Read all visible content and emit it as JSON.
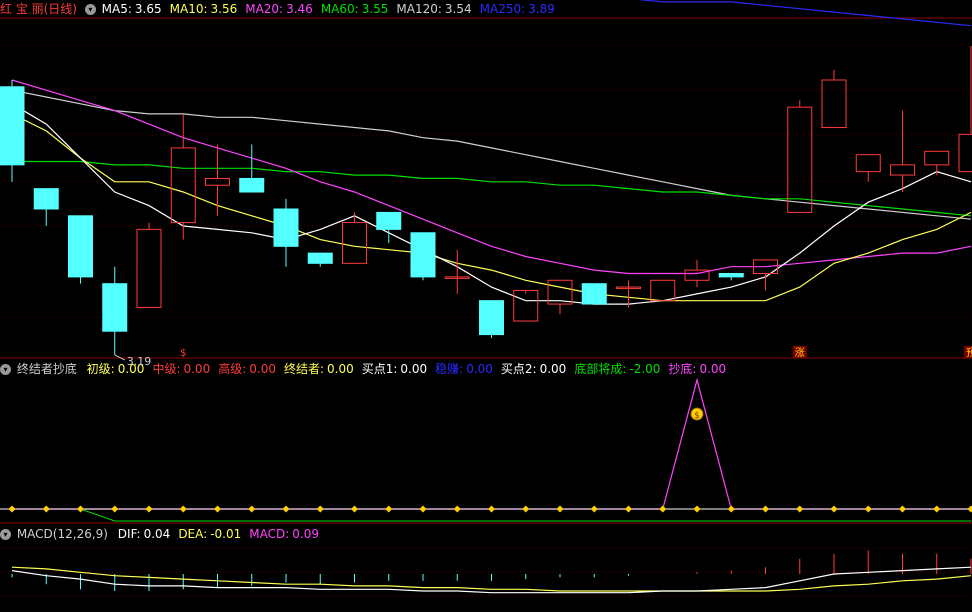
{
  "colors": {
    "up": "#ff3b3b",
    "down": "#54ffff",
    "ma5": "#ffffff",
    "ma10": "#ffff54",
    "ma20": "#ff44ff",
    "ma60": "#00e000",
    "ma120": "#cfcfcf",
    "ma250": "#2a2aff"
  },
  "panel1": {
    "title": "红 宝 丽(日线)",
    "indicators": [
      {
        "label": "MA5:",
        "value": "3.65",
        "color": "#ffffff"
      },
      {
        "label": "MA10:",
        "value": "3.56",
        "color": "#ffff54"
      },
      {
        "label": "MA20:",
        "value": "3.46",
        "color": "#ff44ff"
      },
      {
        "label": "MA60:",
        "value": "3.55",
        "color": "#00e000"
      },
      {
        "label": "MA120:",
        "value": "3.54",
        "color": "#cfcfcf"
      },
      {
        "label": "MA250:",
        "value": "3.89",
        "color": "#2a2aff"
      }
    ],
    "low_label": "3.19",
    "markers": [
      "$",
      "涨",
      "预"
    ]
  },
  "panel2": {
    "title": "终结者抄底",
    "indicators": [
      {
        "label": "初级:",
        "value": "0.00",
        "color": "#ffff54"
      },
      {
        "label": "中级:",
        "value": "0.00",
        "color": "#ff3b3b"
      },
      {
        "label": "高级:",
        "value": "0.00",
        "color": "#ff3b3b"
      },
      {
        "label": "终结者:",
        "value": "0.00",
        "color": "#ffff54"
      },
      {
        "label": "买点1:",
        "value": "0.00",
        "color": "#ffffff"
      },
      {
        "label": "稳赚:",
        "value": "0.00",
        "color": "#2a2aff"
      },
      {
        "label": "买点2:",
        "value": "0.00",
        "color": "#ffffff"
      },
      {
        "label": "底部将成:",
        "value": "-2.00",
        "color": "#00e000"
      },
      {
        "label": "抄底:",
        "value": "0.00",
        "color": "#ff44ff"
      }
    ],
    "signal_icon": "money-bag-icon"
  },
  "panel3": {
    "title": "MACD(12,26,9)",
    "indicators": [
      {
        "label": "DIF:",
        "value": "0.04",
        "color": "#ffffff"
      },
      {
        "label": "DEA:",
        "value": "-0.01",
        "color": "#ffff54"
      },
      {
        "label": "MACD:",
        "value": "0.09",
        "color": "#ff44ff"
      }
    ]
  },
  "chart_data": {
    "type": "candlestick",
    "candles": [
      {
        "o": 3.93,
        "h": 3.95,
        "l": 3.65,
        "c": 3.7
      },
      {
        "o": 3.63,
        "h": 3.63,
        "l": 3.52,
        "c": 3.57
      },
      {
        "o": 3.55,
        "h": 3.55,
        "l": 3.35,
        "c": 3.37
      },
      {
        "o": 3.35,
        "h": 3.4,
        "l": 3.14,
        "c": 3.21
      },
      {
        "o": 3.28,
        "h": 3.53,
        "l": 3.28,
        "c": 3.51
      },
      {
        "o": 3.53,
        "h": 3.85,
        "l": 3.48,
        "c": 3.75
      },
      {
        "o": 3.64,
        "h": 3.76,
        "l": 3.55,
        "c": 3.66
      },
      {
        "o": 3.66,
        "h": 3.76,
        "l": 3.62,
        "c": 3.62
      },
      {
        "o": 3.57,
        "h": 3.6,
        "l": 3.4,
        "c": 3.46
      },
      {
        "o": 3.44,
        "h": 3.44,
        "l": 3.4,
        "c": 3.41
      },
      {
        "o": 3.41,
        "h": 3.56,
        "l": 3.41,
        "c": 3.53
      },
      {
        "o": 3.56,
        "h": 3.56,
        "l": 3.47,
        "c": 3.51
      },
      {
        "o": 3.5,
        "h": 3.5,
        "l": 3.36,
        "c": 3.37
      },
      {
        "o": 3.37,
        "h": 3.45,
        "l": 3.32,
        "c": 3.37
      },
      {
        "o": 3.3,
        "h": 3.3,
        "l": 3.19,
        "c": 3.2
      },
      {
        "o": 3.24,
        "h": 3.32,
        "l": 3.24,
        "c": 3.33
      },
      {
        "o": 3.29,
        "h": 3.36,
        "l": 3.26,
        "c": 3.36
      },
      {
        "o": 3.35,
        "h": 3.35,
        "l": 3.29,
        "c": 3.29
      },
      {
        "o": 3.34,
        "h": 3.36,
        "l": 3.28,
        "c": 3.34
      },
      {
        "o": 3.3,
        "h": 3.36,
        "l": 3.3,
        "c": 3.36
      },
      {
        "o": 3.36,
        "h": 3.42,
        "l": 3.34,
        "c": 3.39
      },
      {
        "o": 3.38,
        "h": 3.38,
        "l": 3.36,
        "c": 3.37
      },
      {
        "o": 3.38,
        "h": 3.42,
        "l": 3.33,
        "c": 3.42
      },
      {
        "o": 3.56,
        "h": 3.89,
        "l": 3.56,
        "c": 3.87
      },
      {
        "o": 3.81,
        "h": 3.98,
        "l": 3.81,
        "c": 3.95
      },
      {
        "o": 3.68,
        "h": 3.73,
        "l": 3.65,
        "c": 3.73
      },
      {
        "o": 3.67,
        "h": 3.86,
        "l": 3.62,
        "c": 3.7
      },
      {
        "o": 3.7,
        "h": 3.74,
        "l": 3.67,
        "c": 3.74
      },
      {
        "o": 3.68,
        "h": 4.05,
        "l": 3.68,
        "c": 3.79
      }
    ],
    "ma5": [
      3.88,
      3.82,
      3.72,
      3.62,
      3.58,
      3.52,
      3.51,
      3.5,
      3.48,
      3.51,
      3.55,
      3.5,
      3.45,
      3.4,
      3.34,
      3.3,
      3.3,
      3.29,
      3.29,
      3.3,
      3.32,
      3.34,
      3.37,
      3.44,
      3.52,
      3.59,
      3.63,
      3.68,
      3.65
    ],
    "ma10": [
      3.85,
      3.8,
      3.72,
      3.65,
      3.65,
      3.62,
      3.58,
      3.55,
      3.52,
      3.48,
      3.46,
      3.45,
      3.44,
      3.41,
      3.39,
      3.36,
      3.34,
      3.32,
      3.31,
      3.3,
      3.3,
      3.3,
      3.3,
      3.34,
      3.41,
      3.44,
      3.48,
      3.51,
      3.56
    ],
    "ma20": [
      3.95,
      3.92,
      3.89,
      3.86,
      3.82,
      3.78,
      3.75,
      3.72,
      3.69,
      3.65,
      3.62,
      3.58,
      3.54,
      3.5,
      3.46,
      3.43,
      3.41,
      3.39,
      3.38,
      3.38,
      3.38,
      3.4,
      3.4,
      3.41,
      3.42,
      3.43,
      3.44,
      3.44,
      3.46
    ],
    "ma60": [
      3.71,
      3.71,
      3.71,
      3.7,
      3.7,
      3.69,
      3.69,
      3.69,
      3.68,
      3.68,
      3.67,
      3.67,
      3.66,
      3.66,
      3.65,
      3.65,
      3.64,
      3.64,
      3.63,
      3.62,
      3.62,
      3.61,
      3.6,
      3.6,
      3.59,
      3.58,
      3.57,
      3.56,
      3.55
    ],
    "ma120": [
      3.92,
      3.9,
      3.88,
      3.86,
      3.85,
      3.85,
      3.84,
      3.84,
      3.83,
      3.82,
      3.81,
      3.8,
      3.78,
      3.77,
      3.75,
      3.73,
      3.71,
      3.69,
      3.67,
      3.65,
      3.63,
      3.61,
      3.6,
      3.59,
      3.58,
      3.57,
      3.56,
      3.55,
      3.54
    ],
    "ma250": [
      4.28,
      4.27,
      4.27,
      4.27,
      4.26,
      4.26,
      4.25,
      4.25,
      4.24,
      4.24,
      4.23,
      4.23,
      4.22,
      4.22,
      4.21,
      4.21,
      4.2,
      4.2,
      4.19,
      4.18,
      4.18,
      4.18,
      4.17,
      4.16,
      4.15,
      4.14,
      4.13,
      4.12,
      4.11
    ],
    "signal_values": [
      0,
      0,
      0,
      0,
      0,
      0,
      0,
      0,
      0,
      0,
      0,
      0,
      0,
      0,
      0,
      0,
      0,
      0,
      0,
      0,
      1,
      0,
      0,
      0,
      0,
      0,
      0,
      0,
      0
    ],
    "green_values": [
      0,
      0,
      0,
      -2,
      -2,
      -2,
      -2,
      -2,
      -2,
      -2,
      -2,
      -2,
      -2,
      -2,
      -2,
      -2,
      -2,
      -2,
      -2,
      -2,
      -2,
      -2,
      -2,
      -2,
      -2,
      -2,
      -2,
      -2,
      -2
    ],
    "dif": [
      0.02,
      -0.01,
      -0.03,
      -0.06,
      -0.07,
      -0.07,
      -0.08,
      -0.08,
      -0.08,
      -0.09,
      -0.09,
      -0.09,
      -0.1,
      -0.1,
      -0.11,
      -0.11,
      -0.11,
      -0.11,
      -0.11,
      -0.1,
      -0.1,
      -0.09,
      -0.08,
      -0.04,
      0.0,
      0.01,
      0.02,
      0.03,
      0.04
    ],
    "dea": [
      0.04,
      0.03,
      0.01,
      -0.01,
      -0.02,
      -0.03,
      -0.04,
      -0.05,
      -0.06,
      -0.06,
      -0.07,
      -0.07,
      -0.08,
      -0.08,
      -0.09,
      -0.09,
      -0.1,
      -0.1,
      -0.1,
      -0.1,
      -0.1,
      -0.1,
      -0.1,
      -0.09,
      -0.07,
      -0.06,
      -0.04,
      -0.03,
      -0.01
    ],
    "macd": [
      -0.02,
      -0.06,
      -0.09,
      -0.1,
      -0.1,
      -0.09,
      -0.08,
      -0.07,
      -0.05,
      -0.06,
      -0.05,
      -0.04,
      -0.04,
      -0.04,
      -0.04,
      -0.03,
      -0.02,
      -0.02,
      -0.01,
      0.0,
      0.01,
      0.02,
      0.04,
      0.09,
      0.12,
      0.14,
      0.12,
      0.12,
      0.09
    ]
  }
}
